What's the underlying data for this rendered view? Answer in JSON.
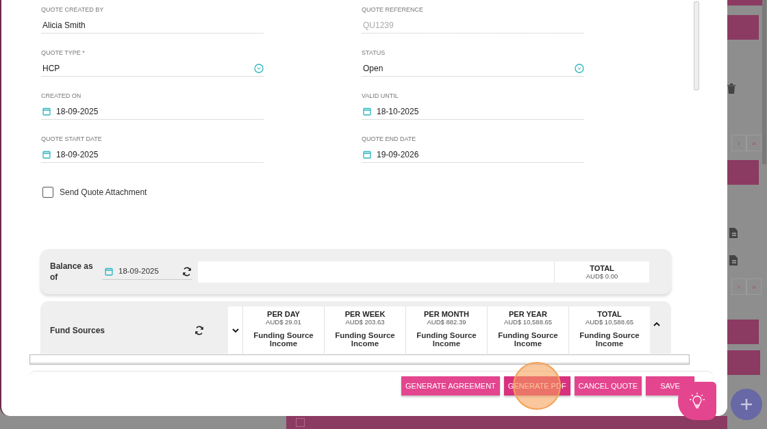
{
  "field_rows": [
    [
      {
        "label": "QUOTE CREATED BY",
        "value": "Alicia Smith",
        "kind": "text"
      },
      {
        "label": "QUOTE REFERENCE",
        "value": "QU1239",
        "kind": "readonly"
      }
    ],
    [
      {
        "label": "QUOTE TYPE *",
        "value": "HCP",
        "kind": "select"
      },
      {
        "label": "STATUS",
        "value": "Open",
        "kind": "select"
      }
    ],
    [
      {
        "label": "CREATED ON",
        "value": "18-09-2025",
        "kind": "date"
      },
      {
        "label": "VALID UNTIL",
        "value": "18-10-2025",
        "kind": "date"
      }
    ],
    [
      {
        "label": "QUOTE START DATE",
        "value": "18-09-2025",
        "kind": "date"
      },
      {
        "label": "QUOTE END DATE",
        "value": "19-09-2026",
        "kind": "date"
      }
    ]
  ],
  "send_attachment": {
    "label": "Send Quote Attachment",
    "checked": false
  },
  "balance": {
    "label": "Balance as of",
    "date": "18-09-2025",
    "total": {
      "title": "TOTAL",
      "amount": "AUD$ 0.00"
    }
  },
  "fund_sources": {
    "label": "Fund Sources",
    "columns": [
      {
        "title": "PER DAY",
        "amount": "AUD$ 29.01",
        "subtitle": "Funding Source Income"
      },
      {
        "title": "PER WEEK",
        "amount": "AUD$ 203.63",
        "subtitle": "Funding Source Income"
      },
      {
        "title": "PER MONTH",
        "amount": "AUD$ 882.39",
        "subtitle": "Funding Source Income"
      },
      {
        "title": "PER YEAR",
        "amount": "AUD$ 10,588.65",
        "subtitle": "Funding Source Income"
      },
      {
        "title": "TOTAL",
        "amount": "AUD$ 10,588.65",
        "subtitle": "Funding Source Income"
      }
    ]
  },
  "buttons": [
    {
      "label": "GENERATE AGREEMENT",
      "clicked": false
    },
    {
      "label": "GENERATE PDF",
      "clicked": true
    },
    {
      "label": "CANCEL QUOTE",
      "clicked": false
    },
    {
      "label": "SAVE",
      "clicked": false
    }
  ],
  "background_page": {
    "pagers": [
      [
        "›",
        "»"
      ],
      [
        "›",
        "»"
      ]
    ],
    "row_checkbox": {
      "checked": false
    }
  }
}
